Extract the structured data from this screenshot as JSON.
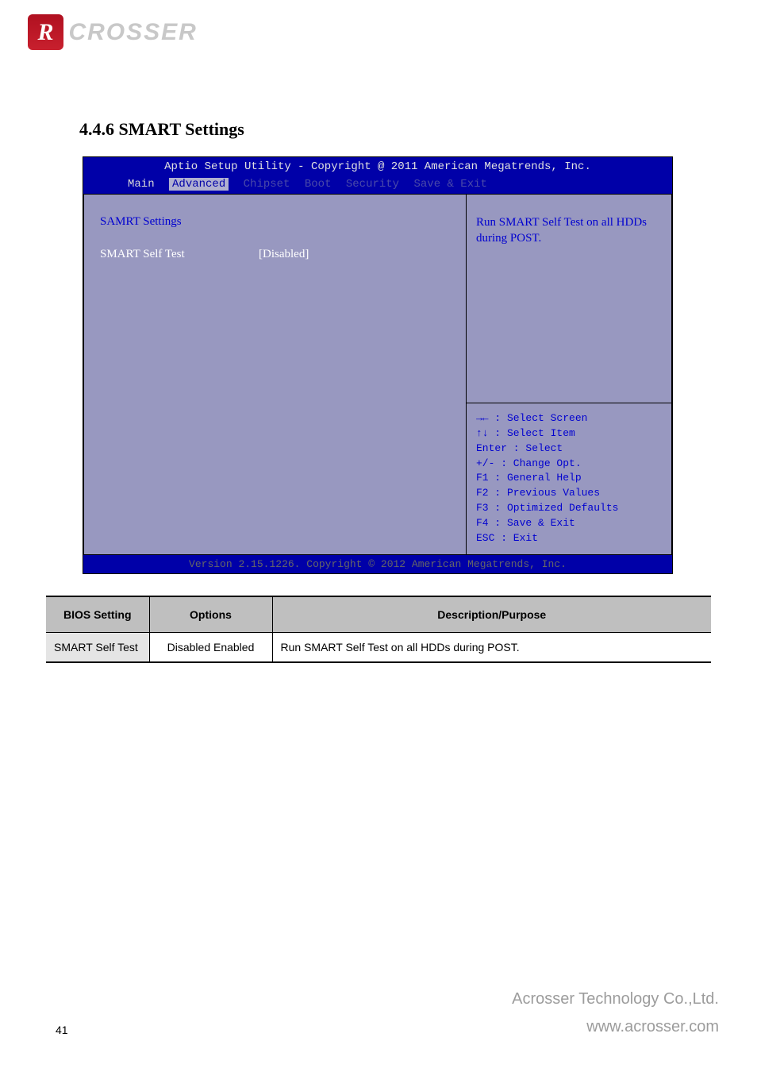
{
  "logo": {
    "icon_letter": "R",
    "brand_text": "CROSSER"
  },
  "section_title": "4.4.6 SMART Settings",
  "bios": {
    "header": "Aptio Setup Utility - Copyright @ 2011 American Megatrends, Inc.",
    "menu": {
      "main": "Main",
      "advanced": "Advanced",
      "chipset": "Chipset",
      "boot": "Boot",
      "security": "Security",
      "save_exit": "Save & Exit"
    },
    "left": {
      "heading": "SAMRT Settings",
      "item_label": "SMART Self Test",
      "item_value": "[Disabled]"
    },
    "help_top": "Run SMART Self Test on all HDDs during POST.",
    "help_bottom": [
      "→← : Select Screen",
      "↑↓ : Select Item",
      "Enter : Select",
      "+/- : Change Opt.",
      "F1 : General Help",
      "F2 : Previous Values",
      "F3 : Optimized Defaults",
      "F4 : Save & Exit",
      "ESC : Exit"
    ],
    "footer": "Version 2.15.1226. Copyright © 2012 American Megatrends, Inc."
  },
  "table": {
    "headers": [
      "BIOS Setting",
      "Options",
      "Description/Purpose"
    ],
    "row": {
      "setting": "SMART Self Test",
      "options": "Disabled Enabled",
      "desc": "Run SMART Self Test on all HDDs during POST."
    }
  },
  "footer": {
    "company": "Acrosser Technology Co.,Ltd.",
    "url": "www.acrosser.com",
    "page": "41"
  }
}
